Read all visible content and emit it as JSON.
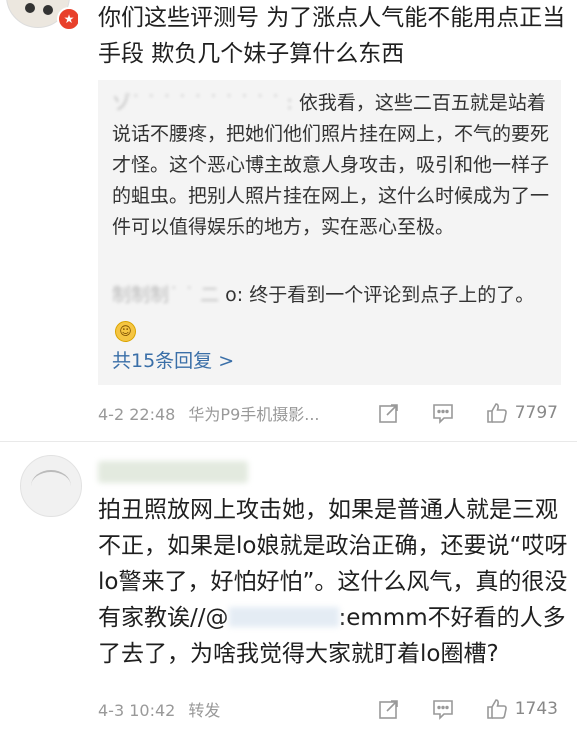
{
  "comment1": {
    "text": "你们这些评测号 为了涨点人气能不能用点正当手段 欺负几个妹子算什么东西",
    "replies": [
      {
        "text": "依我看，这些二百五就是站着说话不腰疼，把她们他们照片挂在网上，不气的要死才怪。这个恶心博主故意人身攻击，吸引和他一样子的蛆虫。把别人照片挂在网上，这什么时候成为了一件可以值得娱乐的地方，实在恶心至极。"
      },
      {
        "text": "o: 终于看到一个评论到点子上的了。"
      }
    ],
    "more_replies_label": "共15条回复 >",
    "time": "4-2 22:48",
    "source": "华为P9手机摄影...",
    "like_count": "7797"
  },
  "comment2": {
    "text_part1": "拍丑照放网上攻击她，如果是普通人就是三观不正，如果是lo娘就是政治正确，还要说“哎呀lo警来了，好怕好怕”。这什么风气，真的很没有家教诶//@",
    "text_part2": ":emmm不好看的人多了去了，为啥我觉得大家就盯着lo圈槽?",
    "time": "4-3 10:42",
    "action": "转发",
    "like_count": "1743"
  },
  "colors": {
    "link": "#3a6fa8",
    "meta": "#999999",
    "reply_bg": "#f4f4f4",
    "badge": "#e8402b"
  }
}
